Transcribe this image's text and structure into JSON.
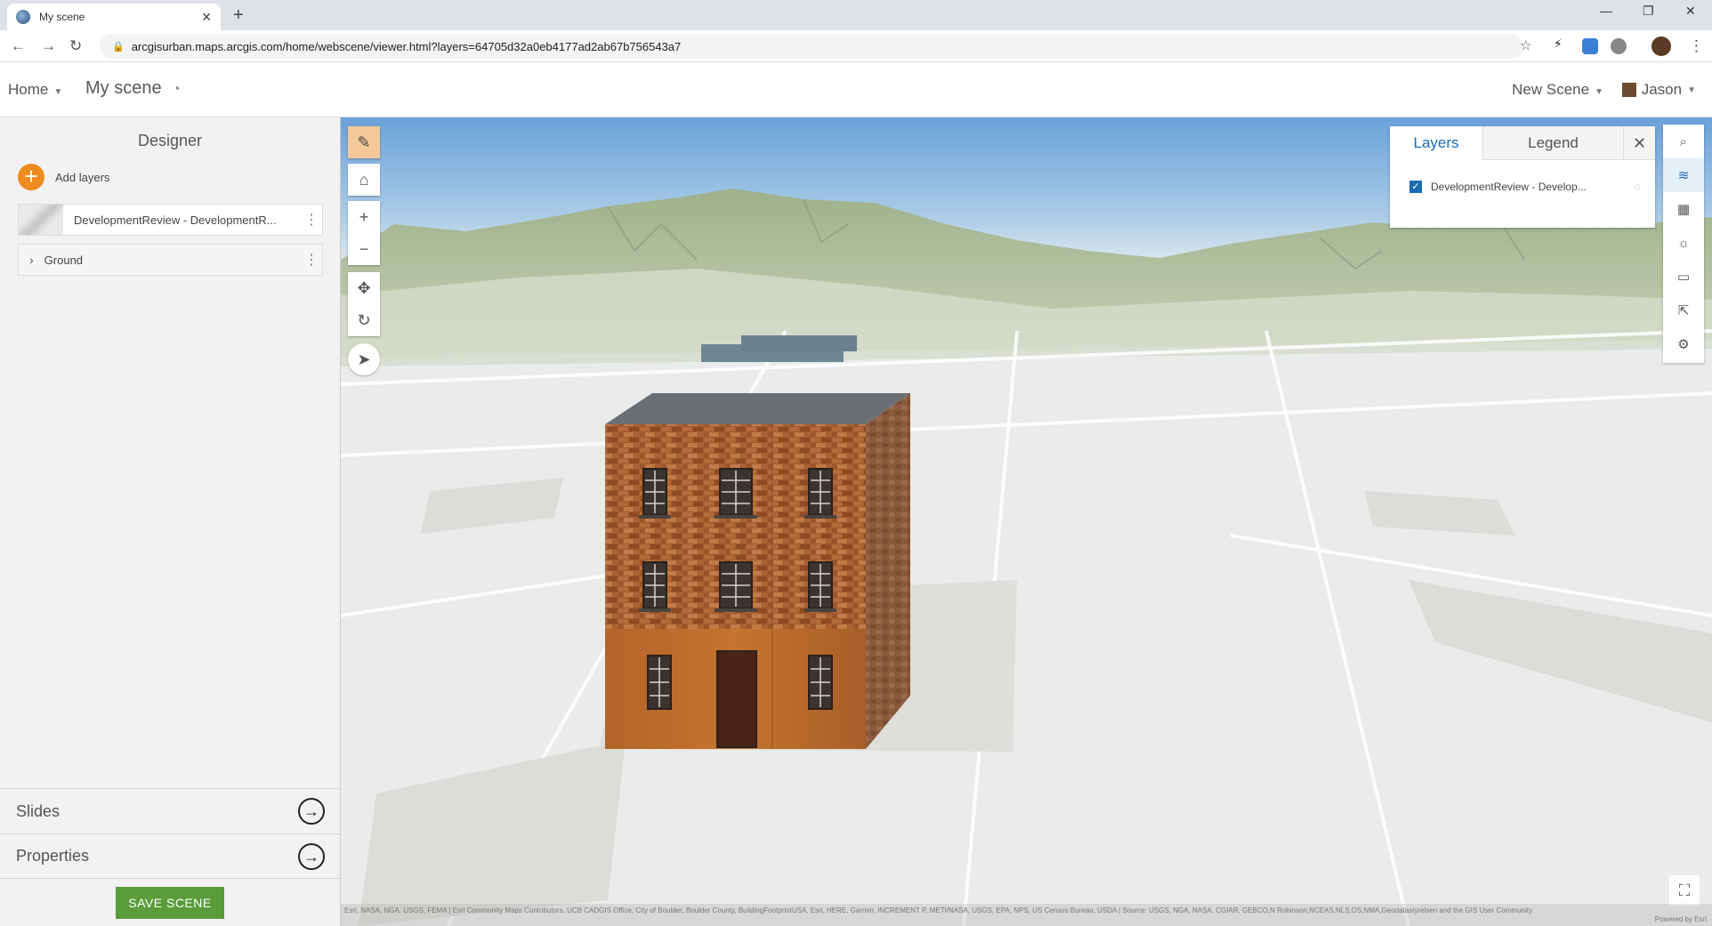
{
  "browser": {
    "tab_title": "My scene",
    "url": "arcgisurban.maps.arcgis.com/home/webscene/viewer.html?layers=64705d32a0eb4177ad2ab67b756543a7"
  },
  "header": {
    "home_label": "Home",
    "scene_title": "My scene",
    "new_scene_label": "New Scene",
    "user_name": "Jason"
  },
  "designer": {
    "title": "Designer",
    "add_layers_label": "Add layers",
    "layers": [
      {
        "label": "DevelopmentReview - DevelopmentR..."
      },
      {
        "label": "Ground"
      }
    ],
    "slides_label": "Slides",
    "properties_label": "Properties",
    "save_label": "SAVE SCENE"
  },
  "layers_panel": {
    "tab_layers": "Layers",
    "tab_legend": "Legend",
    "layer_label": "DevelopmentReview - Develop...",
    "layer_checked": true
  },
  "scene": {
    "attribution": "Esri, NASA, NGA, USGS, FEMA | Esri Community Maps Contributors, UCB CADGIS Office, City of Boulder, Boulder County, BuildingFootprintUSA, Esri, HERE, Garmin, INCREMENT P, METI/NASA, USGS, EPA, NPS, US Census Bureau, USDA | Source: USGS, NGA, NASA, CGIAR, GEBCO,N Robinson,NCEAS,NLS,OS,NMA,Geodatastyrelsen and the GIS User Community",
    "powered_by": "Powered by Esri"
  },
  "colors": {
    "accent": "#f08b21",
    "save_green": "#5a9c3a",
    "active_blue": "#1b6cb1"
  }
}
